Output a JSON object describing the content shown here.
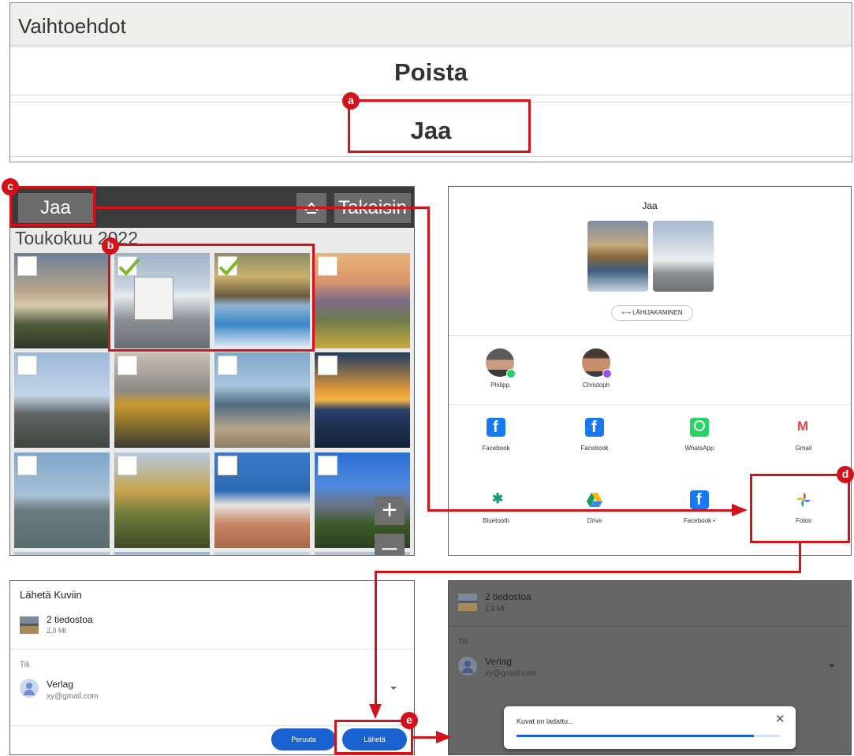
{
  "options_panel": {
    "header": "Vaihtoehdot",
    "delete_label": "Poista",
    "share_label": "Jaa"
  },
  "gallery": {
    "share_button": "Jaa",
    "back_button": "Takaisin",
    "month": "Toukokuu 2022",
    "zoom_in": "+",
    "zoom_out": "–",
    "home_icon": "home-icon"
  },
  "share_sheet": {
    "title": "Jaa",
    "nearby_share": "LÄHIJAKAMINEN",
    "people": [
      {
        "name": "Philipp",
        "badge": "whatsapp"
      },
      {
        "name": "Christoph",
        "badge": "messenger"
      }
    ],
    "apps": [
      {
        "label": "Facebook",
        "icon": "facebook-icon"
      },
      {
        "label": "Facebook",
        "icon": "facebook-icon"
      },
      {
        "label": "WhatsApp",
        "icon": "whatsapp-icon"
      },
      {
        "label": "Gmail",
        "icon": "gmail-icon"
      },
      {
        "label": "Bluetooth",
        "icon": "bluetooth-icon"
      },
      {
        "label": "Drive",
        "icon": "drive-icon"
      },
      {
        "label": "Facebook •",
        "icon": "facebook-icon"
      },
      {
        "label": "Fotos",
        "icon": "photos-icon"
      }
    ]
  },
  "send_panel": {
    "title": "Lähetä Kuviin",
    "files": "2 tiedostoa",
    "size": "2,9 Mt",
    "account_label": "Tili",
    "account_name": "Verlag",
    "account_email": "xy@gmail.com",
    "cancel": "Peruuta",
    "send": "Lähetä"
  },
  "upload_panel": {
    "files": "2 tiedostoa",
    "size": "2,9 Mt",
    "account_label": "Tili",
    "account_name": "Verlag",
    "account_email": "xy@gmail.com",
    "toast_text": "Kuvat on ladattu...",
    "progress": 0.9
  },
  "callouts": [
    "a",
    "b",
    "c",
    "d",
    "e"
  ],
  "colors": {
    "callout_red": "#d3121b",
    "accent_blue": "#1a62d1"
  }
}
